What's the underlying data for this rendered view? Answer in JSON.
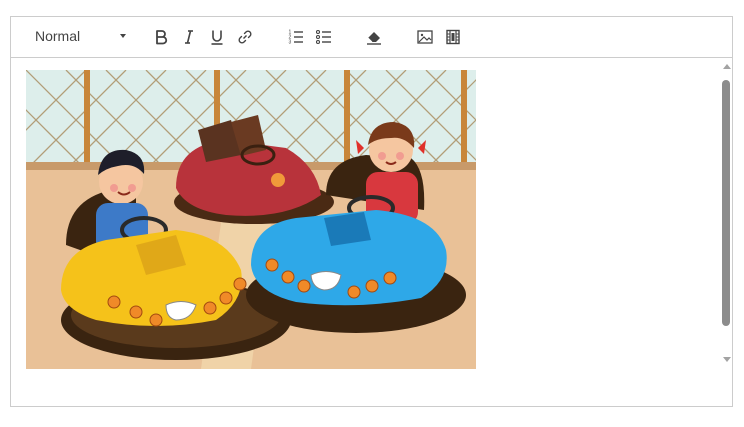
{
  "toolbar": {
    "format_select": {
      "selected": "Normal"
    },
    "buttons": [
      {
        "name": "bold",
        "icon": "bold-icon"
      },
      {
        "name": "italic",
        "icon": "italic-icon"
      },
      {
        "name": "underline",
        "icon": "underline-icon"
      },
      {
        "name": "link",
        "icon": "link-icon"
      },
      {
        "name": "ordered-list",
        "icon": "ordered-list-icon"
      },
      {
        "name": "bullet-list",
        "icon": "bullet-list-icon"
      },
      {
        "name": "clear-format",
        "icon": "eraser-icon"
      },
      {
        "name": "insert-image",
        "icon": "image-icon"
      },
      {
        "name": "insert-video",
        "icon": "film-icon"
      }
    ]
  },
  "content": {
    "image": {
      "description_icon": "bumper-cars-illustration"
    }
  },
  "colors": {
    "border": "#cccccc",
    "icon": "#444444",
    "scroll_thumb": "#8c8c8c"
  }
}
